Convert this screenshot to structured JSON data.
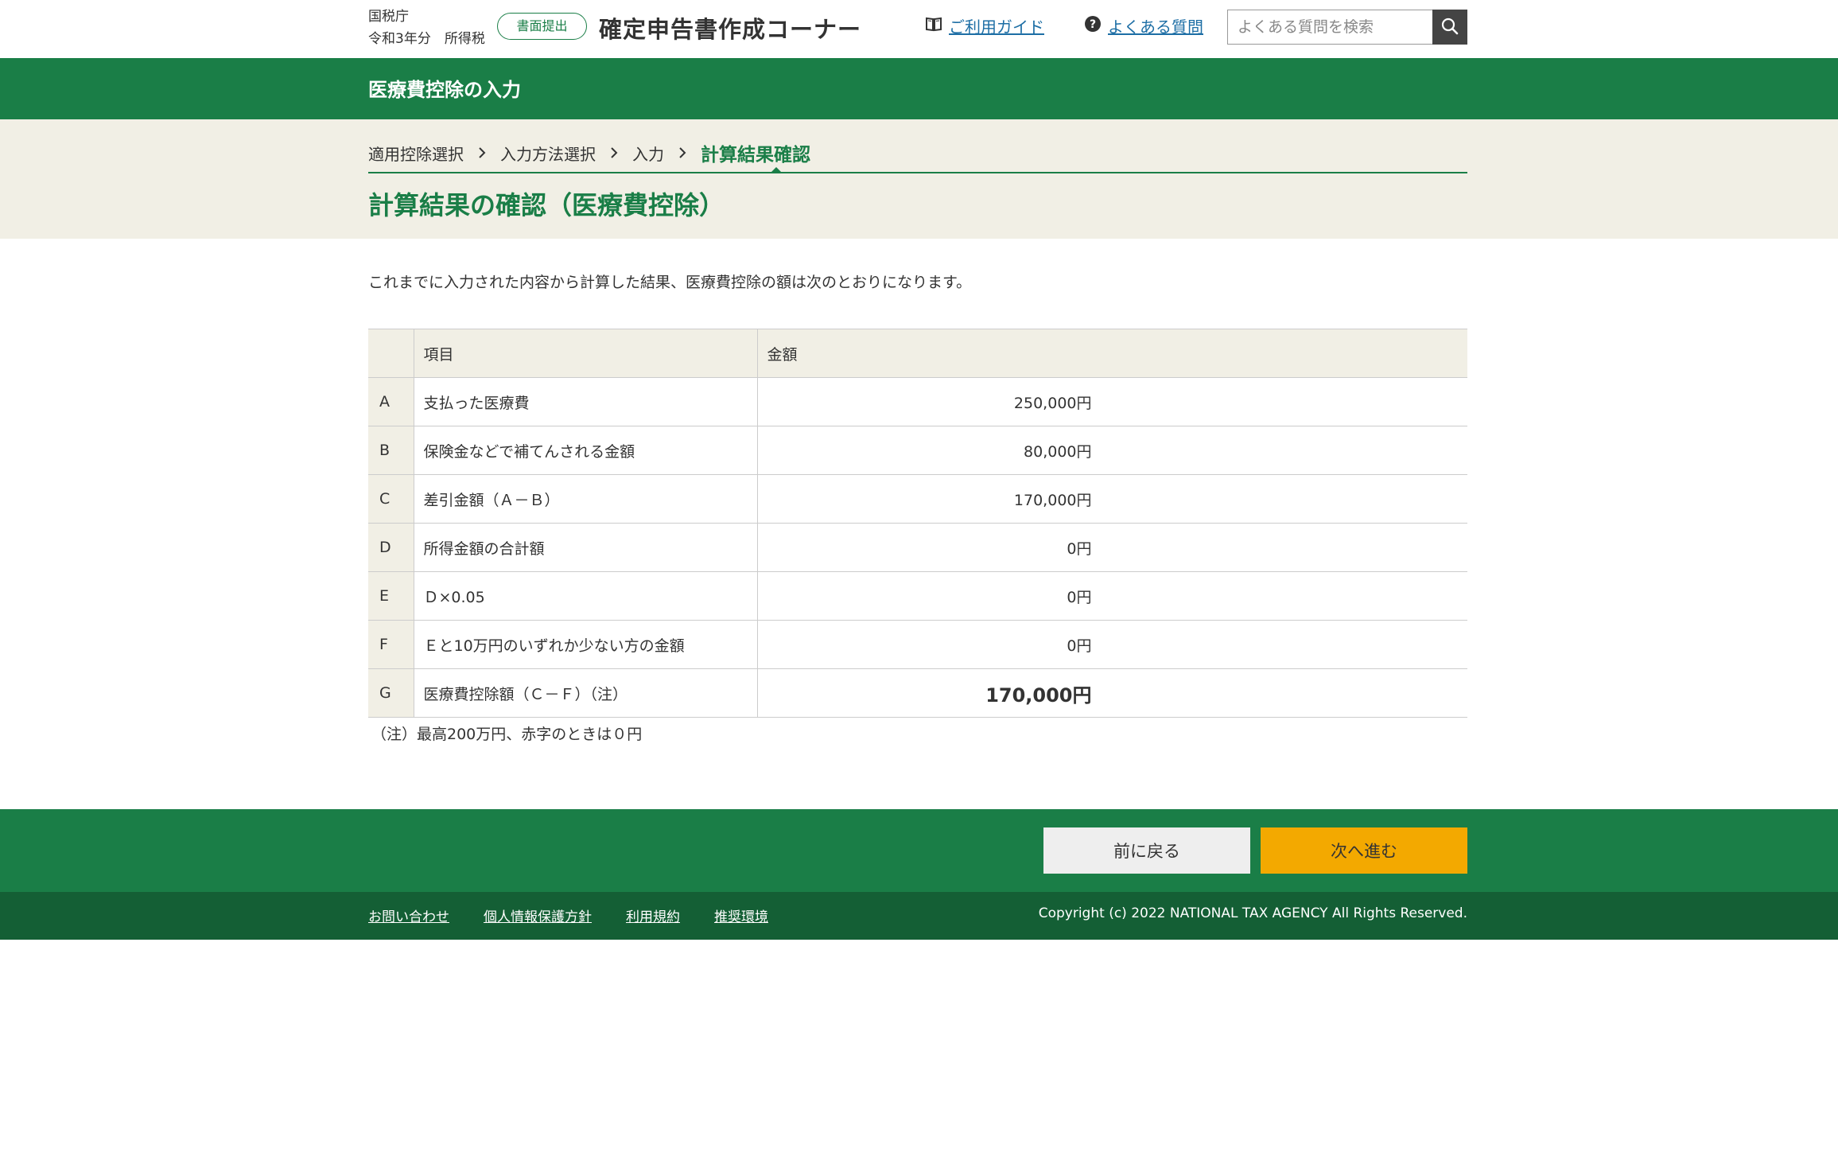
{
  "header": {
    "agency": "国税庁",
    "year_tax": "令和3年分　所得税",
    "submit_mode": "書面提出",
    "site_title": "確定申告書作成コーナー",
    "guide_link": "ご利用ガイド",
    "faq_link": "よくある質問",
    "search_placeholder": "よくある質問を検索"
  },
  "band": {
    "title": "医療費控除の入力"
  },
  "breadcrumb": {
    "items": [
      {
        "label": "適用控除選択"
      },
      {
        "label": "入力方法選択"
      },
      {
        "label": "入力"
      },
      {
        "label": "計算結果確認"
      }
    ],
    "separator": "›"
  },
  "page": {
    "title": "計算結果の確認（医療費控除）",
    "intro": "これまでに入力された内容から計算した結果、医療費控除の額は次のとおりになります。",
    "note": "（注）最高200万円、赤字のときは０円"
  },
  "table": {
    "headers": {
      "item": "項目",
      "amount": "金額"
    },
    "rows": [
      {
        "key": "A",
        "item": "支払った医療費",
        "amount": "250,000円"
      },
      {
        "key": "B",
        "item": "保険金などで補てんされる金額",
        "amount": "80,000円"
      },
      {
        "key": "C",
        "item": "差引金額（Ａ－Ｂ）",
        "amount": "170,000円"
      },
      {
        "key": "D",
        "item": "所得金額の合計額",
        "amount": "0円"
      },
      {
        "key": "E",
        "item": "Ｄ×0.05",
        "amount": "0円"
      },
      {
        "key": "F",
        "item": "Ｅと10万円のいずれか少ない方の金額",
        "amount": "0円"
      },
      {
        "key": "G",
        "item": "医療費控除額（Ｃ－Ｆ）（注）",
        "amount": "170,000円"
      }
    ]
  },
  "actions": {
    "back_label": "前に戻る",
    "next_label": "次へ進む"
  },
  "footer": {
    "links": [
      {
        "label": "お問い合わせ"
      },
      {
        "label": "個人情報保護方針"
      },
      {
        "label": "利用規約"
      },
      {
        "label": "推奨環境"
      }
    ],
    "copyright": "Copyright (c) 2022 NATIONAL TAX AGENCY All Rights Reserved."
  },
  "icons": {
    "guide": "book-icon",
    "faq": "question-circle-icon",
    "search": "magnifier-icon",
    "breadcrumb_sep": "chevron-right-icon"
  },
  "colors": {
    "brand_green": "#1a7e47",
    "footer_green": "#145f35",
    "beige": "#f1efe5",
    "next_button": "#f3a900",
    "back_button": "#eeeeee",
    "link_blue": "#1d6ea5"
  }
}
